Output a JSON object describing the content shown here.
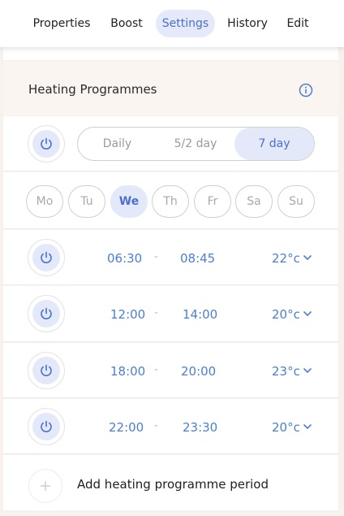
{
  "tabs": [
    {
      "label": "Properties",
      "active": false
    },
    {
      "label": "Boost",
      "active": false
    },
    {
      "label": "Settings",
      "active": true
    },
    {
      "label": "History",
      "active": false
    },
    {
      "label": "Edit",
      "active": false
    }
  ],
  "section": {
    "title": "Heating Programmes",
    "info_icon": "info-icon"
  },
  "mode": {
    "power_icon": "power-icon",
    "options": [
      {
        "label": "Daily",
        "active": false
      },
      {
        "label": "5/2 day",
        "active": false
      },
      {
        "label": "7 day",
        "active": true
      }
    ]
  },
  "days": [
    {
      "label": "Mo",
      "active": false
    },
    {
      "label": "Tu",
      "active": false
    },
    {
      "label": "We",
      "active": true
    },
    {
      "label": "Th",
      "active": false
    },
    {
      "label": "Fr",
      "active": false
    },
    {
      "label": "Sa",
      "active": false
    },
    {
      "label": "Su",
      "active": false
    }
  ],
  "periods": [
    {
      "start": "06:30",
      "sep": "-",
      "end": "08:45",
      "temp": "22°c"
    },
    {
      "start": "12:00",
      "sep": "-",
      "end": "14:00",
      "temp": "20°c"
    },
    {
      "start": "18:00",
      "sep": "-",
      "end": "20:00",
      "temp": "23°c"
    },
    {
      "start": "22:00",
      "sep": "-",
      "end": "23:30",
      "temp": "20°c"
    }
  ],
  "add_period": {
    "label": "Add heating programme period",
    "icon": "plus-icon"
  },
  "colors": {
    "accent": "#4b6fd0",
    "accent_bg": "#e4e9fa",
    "page_bg": "#f7f2ee"
  }
}
